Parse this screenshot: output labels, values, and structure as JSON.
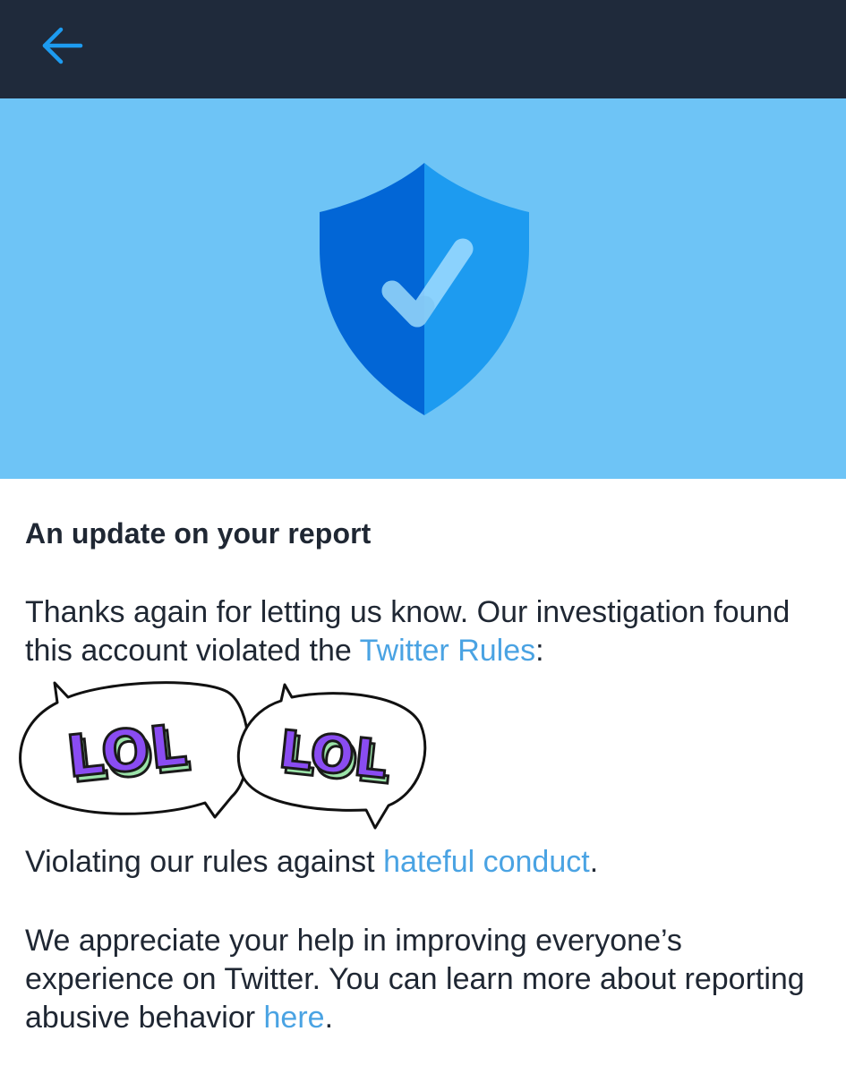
{
  "topbar": {
    "back_icon": "arrow-left-icon",
    "icon_color": "#1d9bf0",
    "background": "#1f2a3b"
  },
  "hero": {
    "background": "#6ec4f6",
    "icon": "shield-check-icon"
  },
  "report": {
    "title": "An update on your report",
    "p1_text": "Thanks again for letting us know. Our investigation found this account violated the ",
    "p1_link": "Twitter Rules",
    "p1_suffix": ":",
    "sticker_words": [
      "LOL",
      "LOL"
    ],
    "p2_text": "Violating our rules against ",
    "p2_link": "hateful conduct",
    "p2_suffix": ".",
    "p3_text": "We appreciate your help in improving everyone’s experience on Twitter. You can learn more about reporting abusive behavior ",
    "p3_link": "here",
    "p3_suffix": ".",
    "link_color": "#4aa3e3",
    "text_color": "#1f2733"
  }
}
